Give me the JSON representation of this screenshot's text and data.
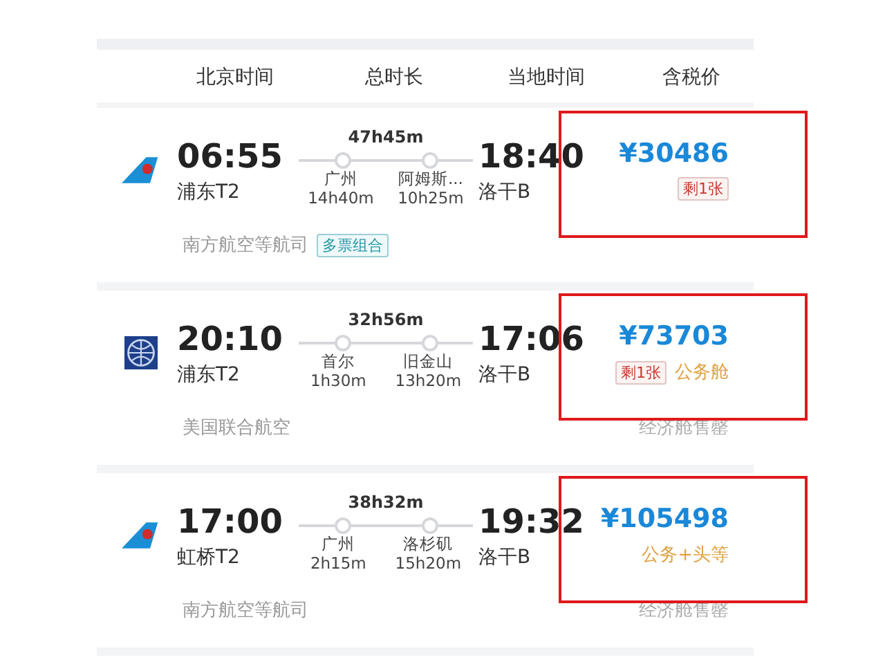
{
  "columns": [
    "北京时间",
    "总时长",
    "当地时间",
    "含税价"
  ],
  "flights": [
    {
      "logo": {
        "kind": "tail"
      },
      "depart_time": "06:55",
      "depart_airport": "浦东T2",
      "duration": "47h45m",
      "stops": [
        {
          "city": "广州",
          "layover": "14h40m"
        },
        {
          "city": "阿姆斯...",
          "layover": "10h25m"
        }
      ],
      "arrive_time": "18:40",
      "arrive_airport": "洛干B",
      "price": "¥30486",
      "tags": [
        {
          "kind": "remaining",
          "text": "剩1张"
        }
      ],
      "airline": "南方航空等航司",
      "airline_tag": "多票组合",
      "highlighted": true
    },
    {
      "logo": {
        "kind": "globe"
      },
      "depart_time": "20:10",
      "depart_airport": "浦东T2",
      "duration": "32h56m",
      "stops": [
        {
          "city": "首尔",
          "layover": "1h30m"
        },
        {
          "city": "旧金山",
          "layover": "13h20m"
        }
      ],
      "arrive_time": "17:06",
      "arrive_airport": "洛干B",
      "price": "¥73703",
      "tags": [
        {
          "kind": "remaining",
          "text": "剩1张"
        },
        {
          "kind": "cabin",
          "text": "公务舱"
        }
      ],
      "airline": "美国联合航空",
      "note": "经济舱售罄",
      "highlighted": true
    },
    {
      "logo": {
        "kind": "tail"
      },
      "depart_time": "17:00",
      "depart_airport": "虹桥T2",
      "duration": "38h32m",
      "stops": [
        {
          "city": "广州",
          "layover": "2h15m"
        },
        {
          "city": "洛杉矶",
          "layover": "15h20m"
        }
      ],
      "arrive_time": "19:32",
      "arrive_airport": "洛干B",
      "price": "¥105498",
      "tags": [
        {
          "kind": "cabin",
          "text": "公务+头等"
        }
      ],
      "airline": "南方航空等航司",
      "note": "经济舱售罄",
      "highlighted": true
    }
  ]
}
